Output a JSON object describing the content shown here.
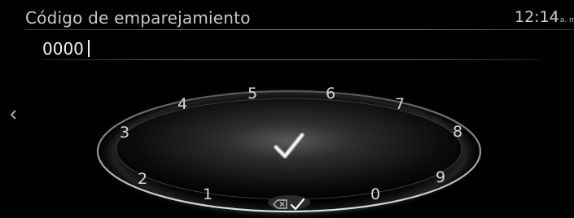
{
  "header": {
    "title": "Código de emparejamiento",
    "clock_time": "12:14",
    "clock_ampm": "a. m"
  },
  "code_entry": {
    "value": "0000"
  },
  "dial": {
    "digits": [
      "1",
      "2",
      "3",
      "4",
      "5",
      "6",
      "7",
      "8",
      "9",
      "0"
    ]
  },
  "icons": {
    "back": "chevron-left-icon",
    "confirm": "checkmark-icon",
    "backspace": "backspace-icon",
    "mode_check": "checkmark-icon"
  },
  "colors": {
    "background": "#000000",
    "text": "#d8d8d8",
    "ring": "#bfbfbf"
  }
}
